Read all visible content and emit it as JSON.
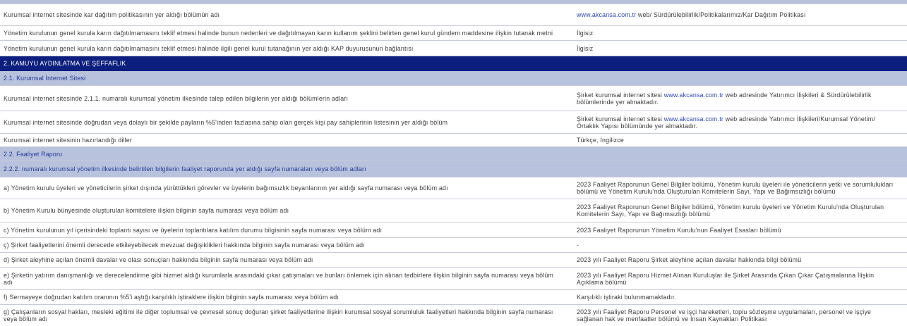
{
  "dividend_policy": {
    "rows": [
      {
        "item": "Kurumsal internet sitesinde kar dağıtım politikasının yer aldığı bölümün adı",
        "answer_link": "www.akcansa.com.tr",
        "answer_after": " web/ Sürdürülebilirlik/Politikalarımız/Kar Dağıtım Politikası"
      },
      {
        "item": "Yönetim kurulunun genel kurula karın dağıtılmamasını teklif etmesi halinde bunun nedenleri ve dağıtılmayan karın kullanım şeklini belirten genel kurul gündem maddesine ilişkin tutanak metni",
        "answer": "İlgisiz"
      },
      {
        "item": "Yönetim kurulunun genel kurula karın dağıtılmamasını teklif etmesi halinde ilgili genel kurul tutanağının yer aldığı KAP duyurusunun bağlantısı",
        "answer": "İlgisiz"
      }
    ]
  },
  "section_2": {
    "title": "2. KAMUYU AYDINLATMA VE ŞEFFAFLIK",
    "website": {
      "title": "2.1. Kurumsal İnternet Sitesi",
      "rows": [
        {
          "item": "Kurumsal internet sitesinde 2.1.1. numaralı kurumsal yönetim ilkesinde talep edilen bilgilerin yer aldığı bölümlerin adları",
          "answer_before": "Şirket kurumsal internet sitesi ",
          "answer_link": "www.akcansa.com.tr",
          "answer_after": " web adresinde Yatırımcı İlişkileri & Sürdürülebilirlik\nbölümlerinde yer almaktadır."
        },
        {
          "item": "Kurumsal internet sitesinde doğrudan veya dolaylı bir şekilde payların %5'inden fazlasına sahip olan gerçek kişi pay sahiplerinin listesinin yer aldığı bölüm",
          "answer_before": "Şirket kurumsal internet sitesi ",
          "answer_link": "www.akcansa.com.tr",
          "answer_after": " web adresinde Yatırımcı İlişkileri/Kurumsal Yönetim/\nOrtaklık Yapısı bölümünde yer almaktadır."
        },
        {
          "item": "Kurumsal internet sitesinin hazırlandığı diller",
          "answer": "Türkçe, İngilizce"
        }
      ]
    },
    "annual_report": {
      "title": "2.2. Faaliyet Raporu",
      "group_title": "2.2.2. numaralı kurumsal yönetim ilkesinde belirtilen bilgilerin faaliyet raporunda yer aldığı sayfa numaraları veya bölüm adları",
      "rows": [
        {
          "item": "a) Yönetim kurulu üyeleri ve yöneticilerin şirket dışında yürüttükleri görevler ve üyelerin bağımsızlık beyanlarının yer aldığı sayfa numarası veya bölüm adı",
          "answer": "2023 Faaliyet Raporunun Genel Bilgiler bölümü, Yönetim kurulu üyeleri ile yöneticilerin yetki ve sorumlulukları\nbölümü ve Yönetim Kurulu'nda Oluşturulan Komitelerin Sayı, Yapı ve Bağımsızlığı bölümü"
        },
        {
          "item": "b) Yönetim Kurulu bünyesinde oluşturulan komitelere ilişkin bilginin sayfa numarası veya bölüm adı",
          "answer": "2023 Faaliyet Raporunun Genel Bilgiler bölümü, Yönetim kurulu üyeleri ve Yönetim Kurulu'nda Oluşturulan\nKomitelerin Sayı, Yapı ve Bağımsızlığı bölümü"
        },
        {
          "item": "c) Yönetim kurulunun yıl içerisindeki toplantı sayısı ve üyelerin toplantılara katılım durumu bilgisinin sayfa numarası veya bölüm adı",
          "answer": "2023 Faaliyet Raporunun Yönetim Kurulu'nun Faaliyet Esasları bölümü"
        },
        {
          "item": "ç) Şirket faaliyetlerini önemli derecede etkileyebilecek mevzuat değişiklikleri hakkında bilginin sayfa numarası veya bölüm adı",
          "answer": "-"
        },
        {
          "item": "d) Şirket aleyhine açılan önemli davalar ve olası sonuçları hakkında bilginin sayfa numarası veya bölüm adı",
          "answer": "2023 yılı Faaliyet Raporu Şirket aleyhine açılan davalar hakkında bilgi bölümü"
        },
        {
          "item": "e) Şirketin yatırım danışmanlığı ve derecelendirme gibi hizmet aldığı kurumlarla arasındaki çıkar çatışmaları ve bunları önlemek için alınan tedbirlere ilişkin bilginin sayfa numarası veya bölüm\nadı",
          "answer": "2023 yılı Faaliyet Raporu Hizmet Alınan Kuruluşlar ile Şirket Arasında Çıkan Çıkar Çatışmalarına İlişkin\nAçıklama bölümü"
        },
        {
          "item": "f) Sermayeye doğrudan katılım oranının %5'i aştığı karşılıklı iştiraklere ilişkin bilginin sayfa numarası veya bölüm adı",
          "answer": "Karşılıklı iştiraki bulunmamaktadır."
        },
        {
          "item": "g) Çalışanların sosyal hakları, mesleki eğitimi ile diğer toplumsal ve çevresel sonuç doğuran şirket faaliyetlerine ilişkin kurumsal sosyal sorumluluk faaliyetleri hakkında bilginin sayfa numarası\nveya bölüm adı",
          "answer": "2023 yılı Faaliyet Raporu Personel ve işçi hareketleri, toplu sözleşme uygulamaları, personel ve işçiye\nsağlanan hak ve menfaatler bölümü ve İnsan Kaynakları Politikası"
        }
      ]
    }
  },
  "theme": {
    "section_header_bg": "#0c1e7e",
    "subsection_bg": "#b8c2dd",
    "subsection_text": "#1e3a94",
    "link": "#2e46b5",
    "text": "#3a3a3a",
    "rule": "#c6ccd8"
  }
}
